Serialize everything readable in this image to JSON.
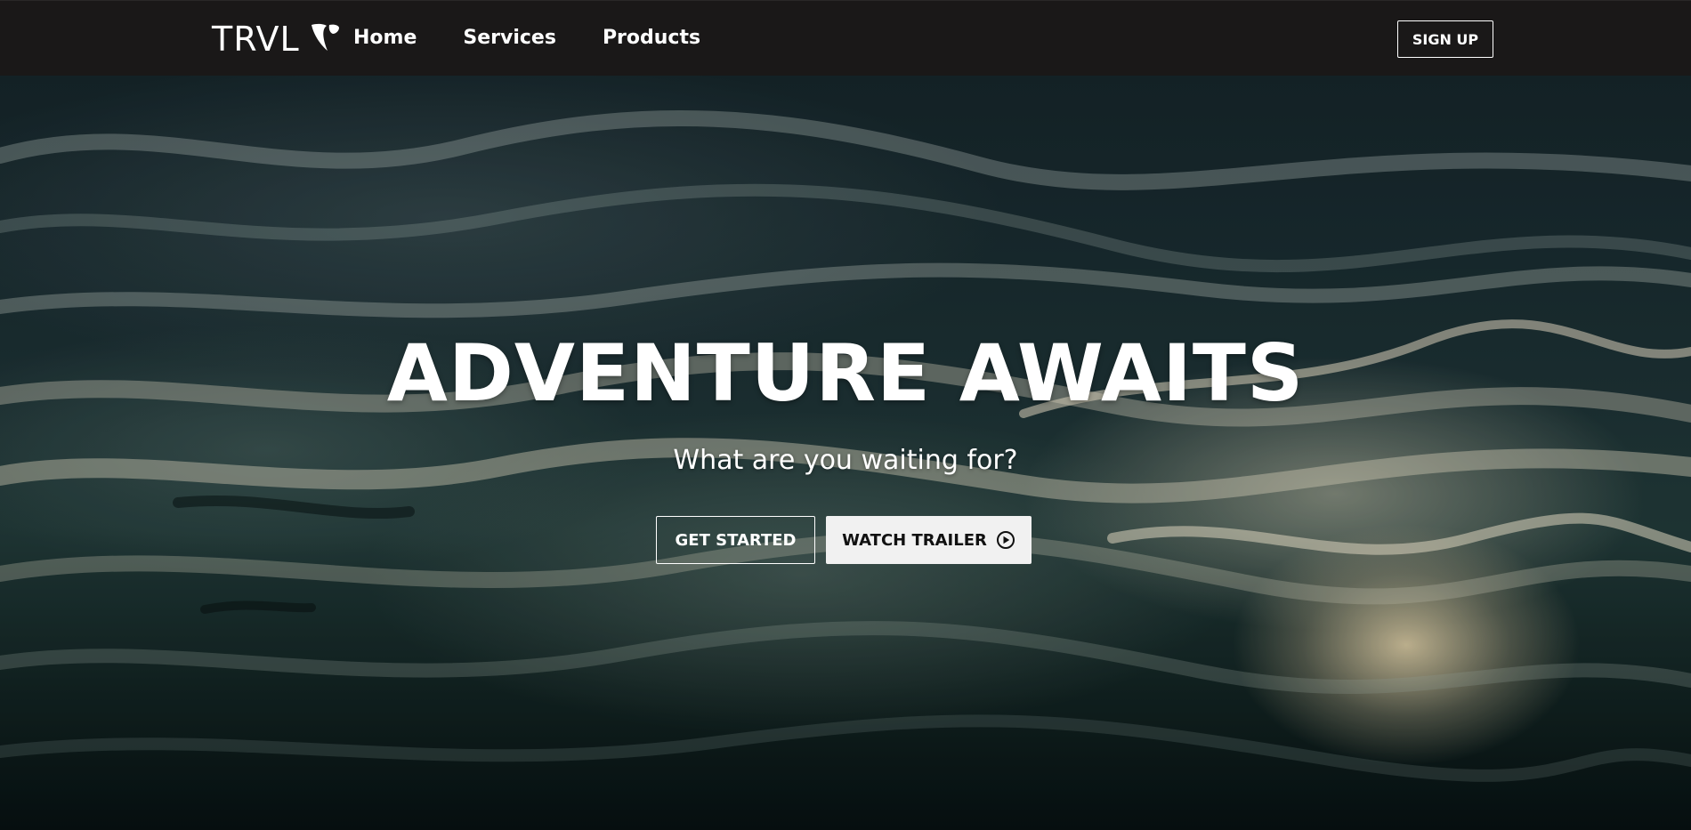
{
  "nav": {
    "logo_text": "TRVL",
    "logo_icon": "typo3-shield-icon",
    "links": [
      {
        "label": "Home"
      },
      {
        "label": "Services"
      },
      {
        "label": "Products"
      }
    ],
    "signup_label": "SIGN UP"
  },
  "hero": {
    "title": "ADVENTURE AWAITS",
    "subtitle": "What are you waiting for?",
    "get_started_label": "GET STARTED",
    "watch_trailer_label": "WATCH TRAILER",
    "watch_trailer_icon": "play-circle-icon",
    "background": "dark rippling water at sunset"
  },
  "colors": {
    "navbar_bg": "#1a1818",
    "text": "#ffffff",
    "secondary_button_bg": "#f1f1f1",
    "secondary_button_text": "#111111"
  }
}
